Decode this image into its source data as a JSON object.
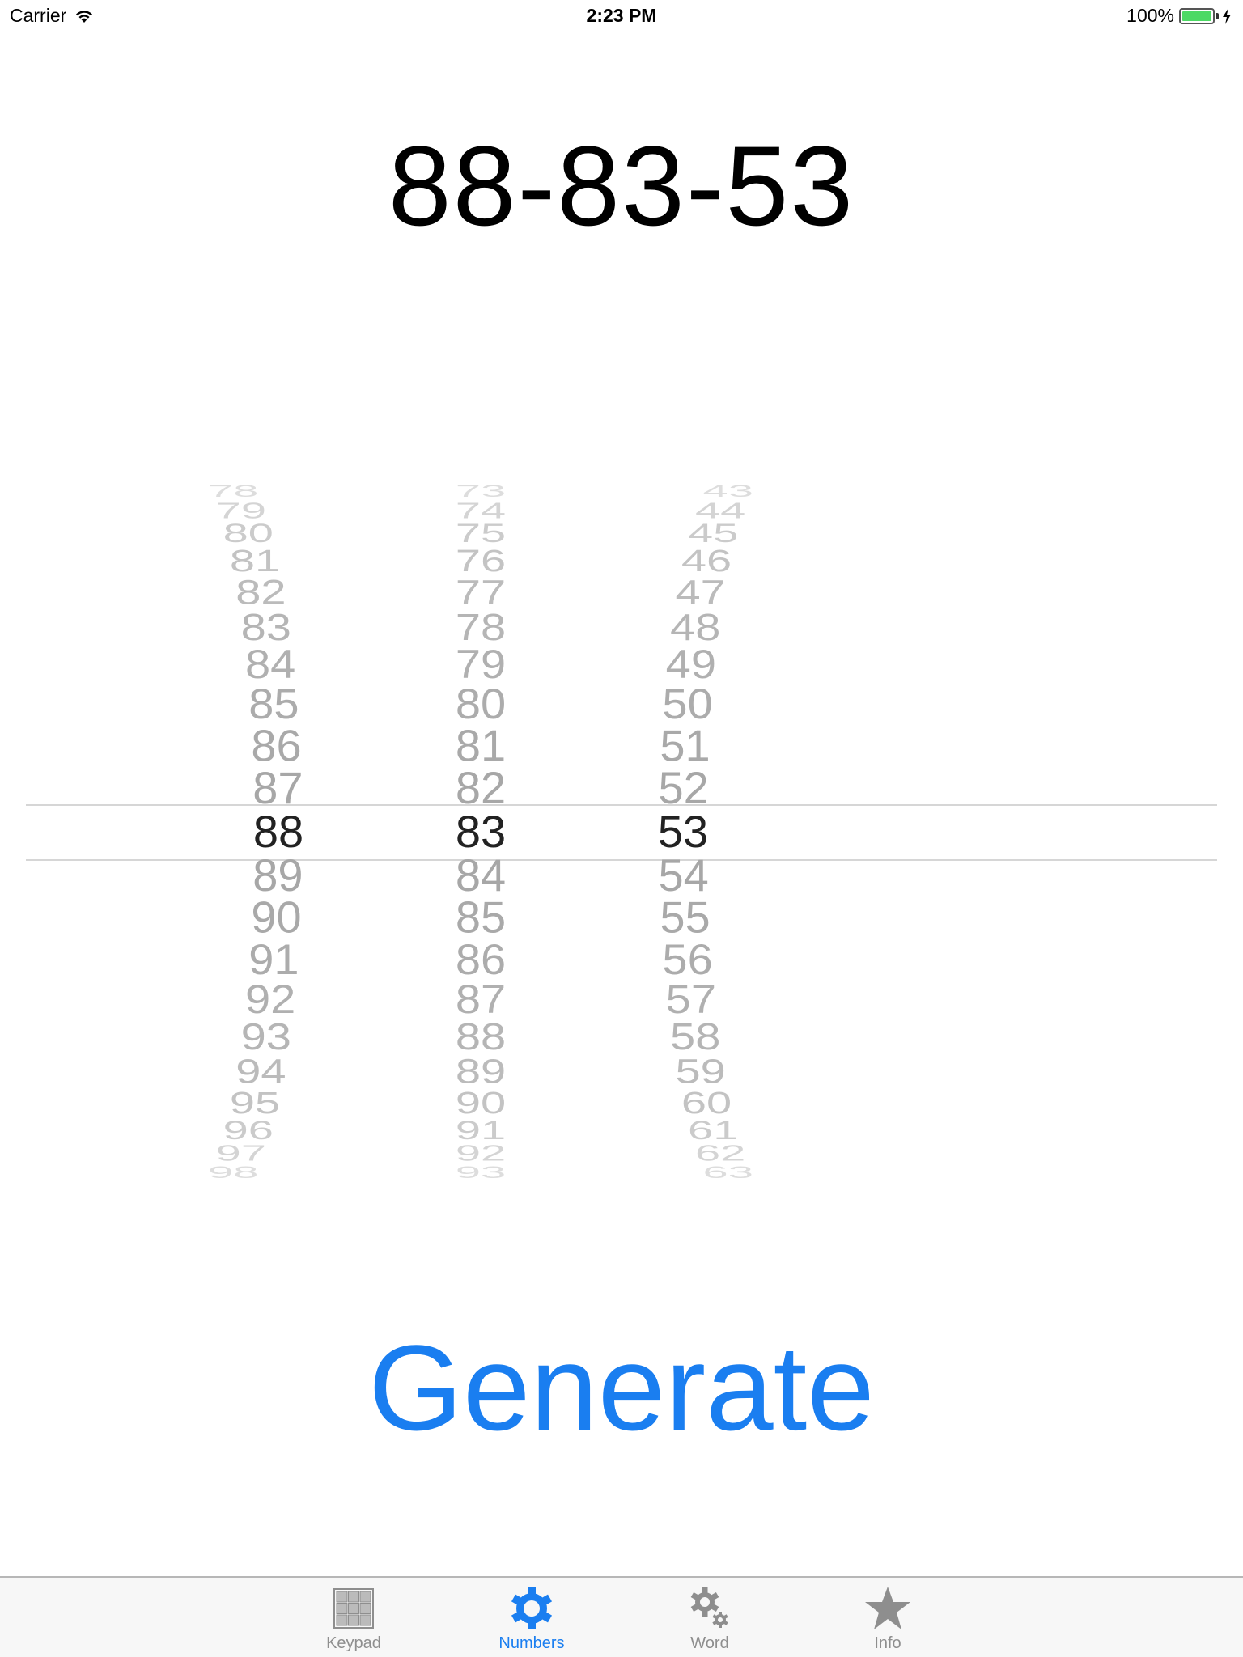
{
  "status_bar": {
    "carrier": "Carrier",
    "time": "2:23 PM",
    "battery_percent": "100%",
    "battery_level": 1.0,
    "wifi_icon": "wifi-icon",
    "battery_icon": "battery-icon",
    "charging_icon": "charging-bolt-icon"
  },
  "code": {
    "value": "88-83-53"
  },
  "picker": {
    "columns": [
      {
        "name": "first-number",
        "selected": "88",
        "above": [
          "78",
          "79",
          "80",
          "81",
          "82",
          "83",
          "84",
          "85",
          "86",
          "87"
        ],
        "below": [
          "89",
          "90",
          "91",
          "92",
          "93",
          "94",
          "95",
          "96",
          "97",
          "98"
        ]
      },
      {
        "name": "second-number",
        "selected": "83",
        "above": [
          "73",
          "74",
          "75",
          "76",
          "77",
          "78",
          "79",
          "80",
          "81",
          "82"
        ],
        "below": [
          "84",
          "85",
          "86",
          "87",
          "88",
          "89",
          "90",
          "91",
          "92",
          "93"
        ]
      },
      {
        "name": "third-number",
        "selected": "53",
        "above": [
          "43",
          "44",
          "45",
          "46",
          "47",
          "48",
          "49",
          "50",
          "51",
          "52"
        ],
        "below": [
          "54",
          "55",
          "56",
          "57",
          "58",
          "59",
          "60",
          "61",
          "62",
          "63"
        ]
      }
    ]
  },
  "generate_button": {
    "label": "Generate"
  },
  "tab_bar": {
    "tabs": [
      {
        "label": "Keypad",
        "icon": "keypad-icon",
        "active": false
      },
      {
        "label": "Numbers",
        "icon": "gear-icon",
        "active": true
      },
      {
        "label": "Word",
        "icon": "gears-icon",
        "active": false
      },
      {
        "label": "Info",
        "icon": "star-icon",
        "active": false
      }
    ]
  },
  "colors": {
    "accent": "#1a7ef0",
    "battery": "#4cd964",
    "inactive_tab": "#8e8e8e",
    "picker_unselected": "#a7a7a7"
  }
}
